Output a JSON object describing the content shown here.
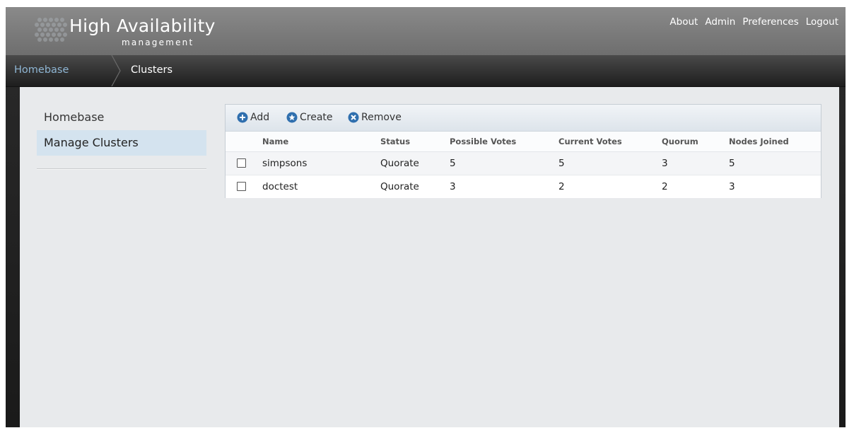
{
  "app": {
    "title": "High Availability",
    "subtitle": "management"
  },
  "topnav": [
    "About",
    "Admin",
    "Preferences",
    "Logout"
  ],
  "breadcrumb": {
    "home": "Homebase",
    "current": "Clusters"
  },
  "sidebar": {
    "items": [
      {
        "label": "Homebase",
        "active": false
      },
      {
        "label": "Manage Clusters",
        "active": true
      }
    ]
  },
  "toolbar": {
    "add_label": "Add",
    "add_icon": "plus-circle-icon",
    "create_label": "Create",
    "create_icon": "star-circle-icon",
    "remove_label": "Remove",
    "remove_icon": "x-circle-icon"
  },
  "table": {
    "columns": [
      "Name",
      "Status",
      "Possible Votes",
      "Current Votes",
      "Quorum",
      "Nodes Joined"
    ],
    "rows": [
      [
        "simpsons",
        "Quorate",
        "5",
        "5",
        "3",
        "5"
      ],
      [
        "doctest",
        "Quorate",
        "3",
        "2",
        "2",
        "3"
      ]
    ]
  },
  "colors": {
    "accent": "#2f6fae",
    "breadcrumb_link": "#8fb6d4",
    "sidebar_active": "#d4e3ef"
  }
}
